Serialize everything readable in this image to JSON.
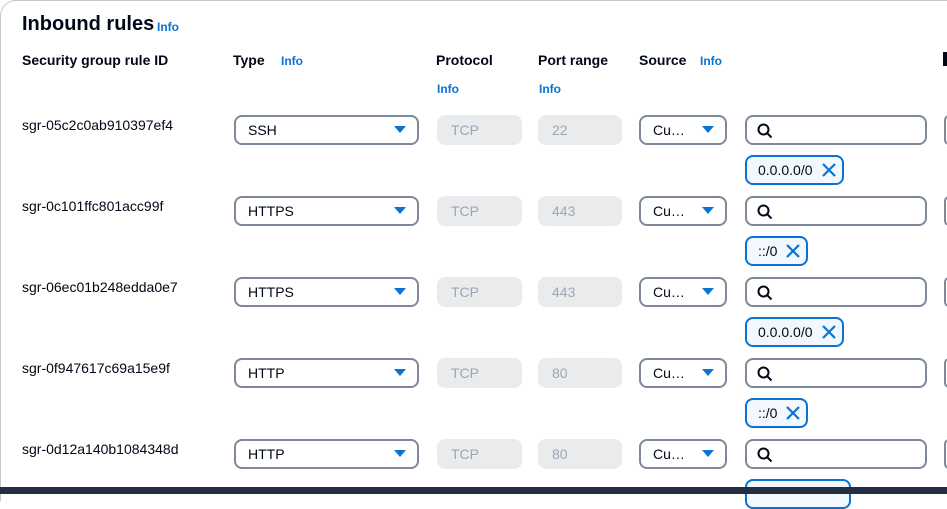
{
  "section": {
    "title": "Inbound rules",
    "info": "Info"
  },
  "headers": {
    "rule_id": "Security group rule ID",
    "type": "Type",
    "type_info": "Info",
    "protocol": "Protocol",
    "protocol_info": "Info",
    "port_range": "Port range",
    "port_info": "Info",
    "source": "Source",
    "source_info": "Info"
  },
  "rules": [
    {
      "id": "sgr-05c2c0ab910397ef4",
      "type": "SSH",
      "protocol": "TCP",
      "port": "22",
      "source_type": "Cu…",
      "source_token": "0.0.0.0/0"
    },
    {
      "id": "sgr-0c101ffc801acc99f",
      "type": "HTTPS",
      "protocol": "TCP",
      "port": "443",
      "source_type": "Cu…",
      "source_token": "::/0"
    },
    {
      "id": "sgr-06ec01b248edda0e7",
      "type": "HTTPS",
      "protocol": "TCP",
      "port": "443",
      "source_type": "Cu…",
      "source_token": "0.0.0.0/0"
    },
    {
      "id": "sgr-0f947617c69a15e9f",
      "type": "HTTP",
      "protocol": "TCP",
      "port": "80",
      "source_type": "Cu…",
      "source_token": "::/0"
    },
    {
      "id": "sgr-0d12a140b1084348d",
      "type": "HTTP",
      "protocol": "TCP",
      "port": "80",
      "source_type": "Cu…",
      "source_token": ""
    }
  ],
  "icons": {
    "search": "search-icon",
    "remove": "close-icon",
    "dropdown": "caret-down-icon"
  },
  "colors": {
    "accent": "#0972d3",
    "text": "#000716",
    "disabled_text": "#9ba7b6",
    "border": "#7d8998"
  }
}
